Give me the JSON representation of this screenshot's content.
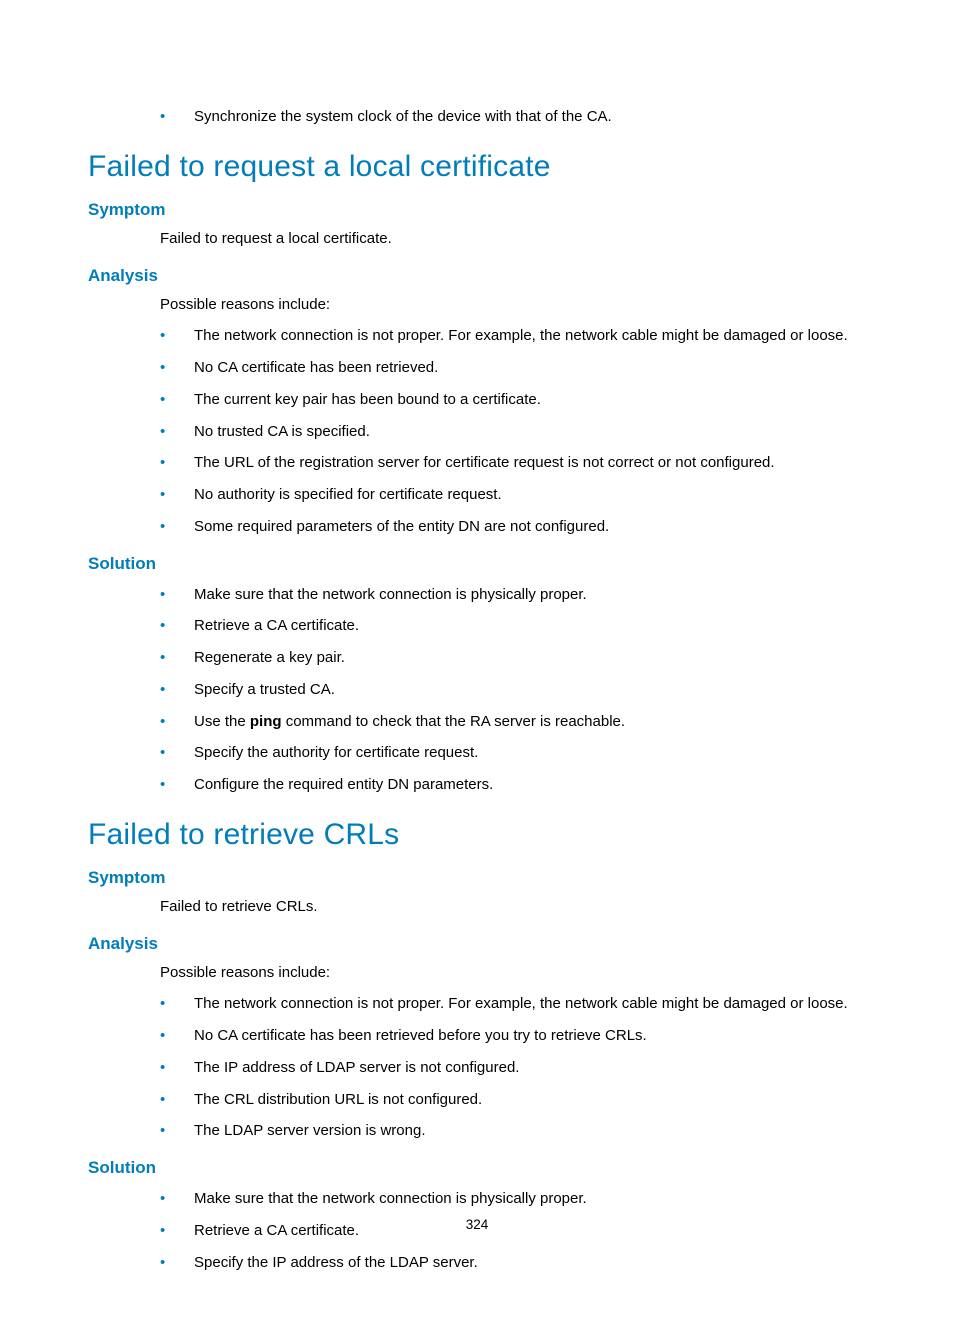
{
  "top_bullets": [
    "Synchronize the system clock of the device with that of the CA."
  ],
  "section1": {
    "title": "Failed to request a local certificate",
    "symptom": {
      "label": "Symptom",
      "text": "Failed to request a local certificate."
    },
    "analysis": {
      "label": "Analysis",
      "intro": "Possible reasons include:",
      "items": [
        "The network connection is not proper. For example, the network cable might be damaged or loose.",
        "No CA certificate has been retrieved.",
        "The current key pair has been bound to a certificate.",
        "No trusted CA is specified.",
        "The URL of the registration server for certificate request is not correct or not configured.",
        "No authority is specified for certificate request.",
        "Some required parameters of the entity DN are not configured."
      ]
    },
    "solution": {
      "label": "Solution",
      "items": [
        "Make sure that the network connection is physically proper.",
        "Retrieve a CA certificate.",
        "Regenerate a key pair.",
        "Specify a trusted CA.",
        {
          "prefix": "Use the ",
          "bold": "ping",
          "suffix": " command to check that the RA server is reachable."
        },
        "Specify the authority for certificate request.",
        "Configure the required entity DN parameters."
      ]
    }
  },
  "section2": {
    "title": "Failed to retrieve CRLs",
    "symptom": {
      "label": "Symptom",
      "text": "Failed to retrieve CRLs."
    },
    "analysis": {
      "label": "Analysis",
      "intro": "Possible reasons include:",
      "items": [
        "The network connection is not proper. For example, the network cable might be damaged or loose.",
        "No CA certificate has been retrieved before you try to retrieve CRLs.",
        "The IP address of LDAP server is not configured.",
        "The CRL distribution URL is not configured.",
        "The LDAP server version is wrong."
      ]
    },
    "solution": {
      "label": "Solution",
      "items": [
        "Make sure that the network connection is physically proper.",
        "Retrieve a CA certificate.",
        "Specify the IP address of the LDAP server."
      ]
    }
  },
  "page_number": "324"
}
